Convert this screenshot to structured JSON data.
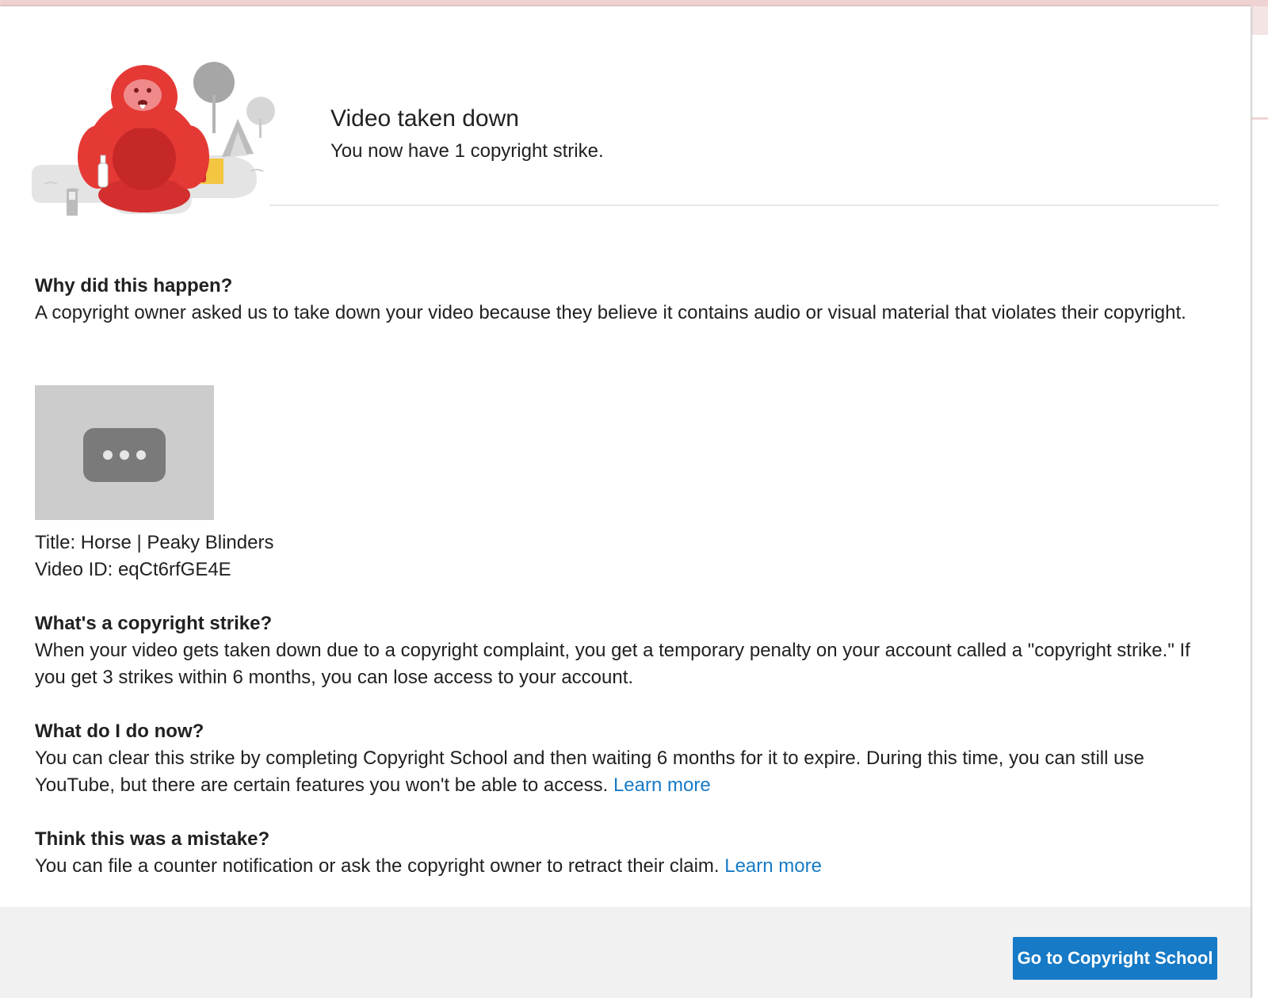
{
  "dialog": {
    "title": "Video taken down",
    "subtitle": "You now have 1 copyright strike."
  },
  "sections": {
    "why": {
      "heading": "Why did this happen?",
      "body": "A copyright owner asked us to take down your video because they believe it contains audio or visual material that violates their copyright."
    },
    "strike": {
      "heading": "What's a copyright strike?",
      "body": "When your video gets taken down due to a copyright complaint, you get a temporary penalty on your account called a \"copyright strike.\" If you get 3 strikes within 6 months, you can lose access to your account."
    },
    "now": {
      "heading": "What do I do now?",
      "body": "You can clear this strike by completing Copyright School and then waiting 6 months for it to expire. During this time, you can still use YouTube, but there are certain features you won't be able to access. ",
      "link": "Learn more"
    },
    "mistake": {
      "heading": "Think this was a mistake?",
      "body": "You can file a counter notification or ask the copyright owner to retract their claim. ",
      "link": "Learn more"
    }
  },
  "video": {
    "title_line": "Title: Horse | Peaky Blinders",
    "id_line": "Video ID: eqCt6rfGE4E",
    "thumbnail_icon": "ellipsis-placeholder-icon"
  },
  "footer": {
    "primary_button": "Go to Copyright School"
  },
  "colors": {
    "accent": "#167ac6",
    "text": "#212121",
    "footer_bg": "#f1f1f1",
    "mascot": "#e53935"
  }
}
